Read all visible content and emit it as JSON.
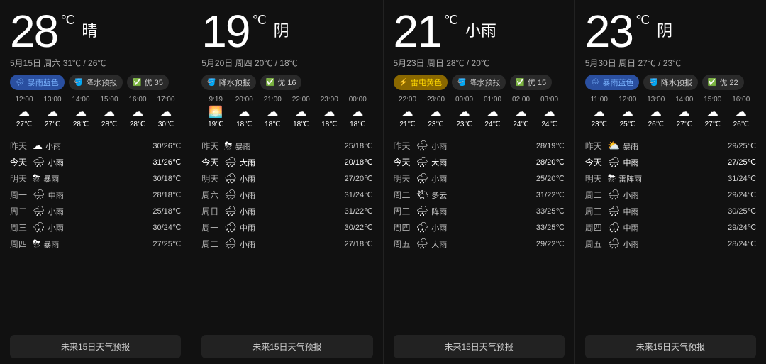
{
  "panels": [
    {
      "id": "panel1",
      "temp": "28",
      "unit": "℃",
      "desc": "晴",
      "date": "5月15日 周六",
      "high": "31℃",
      "low": "26℃",
      "badges": [
        {
          "label": "暴雨蓝色",
          "type": "blue",
          "icon": "🌧"
        },
        {
          "label": "降水预报",
          "type": "dark",
          "icon": "🪣"
        },
        {
          "label": "优 35",
          "type": "dark",
          "icon": "✅"
        }
      ],
      "hourly": [
        {
          "time": "12:00",
          "icon": "☁",
          "temp": "27℃"
        },
        {
          "time": "13:00",
          "icon": "☁",
          "temp": "27℃"
        },
        {
          "time": "14:00",
          "icon": "☁",
          "temp": "28℃"
        },
        {
          "time": "15:00",
          "icon": "☁",
          "temp": "28℃"
        },
        {
          "time": "16:00",
          "icon": "☁",
          "temp": "28℃"
        },
        {
          "time": "17:00",
          "icon": "☁",
          "temp": "30℃"
        }
      ],
      "forecast": [
        {
          "day": "昨天",
          "icon": "☁",
          "label": "小雨",
          "temp": "30/26℃",
          "today": false
        },
        {
          "day": "今天",
          "icon": "🌧",
          "label": "小雨",
          "temp": "31/26℃",
          "today": true
        },
        {
          "day": "明天",
          "icon": "⛈",
          "label": "暴雨",
          "temp": "30/18℃",
          "today": false
        },
        {
          "day": "周一",
          "icon": "🌧",
          "label": "中雨",
          "temp": "28/18℃",
          "today": false
        },
        {
          "day": "周二",
          "icon": "🌧",
          "label": "小雨",
          "temp": "25/18℃",
          "today": false
        },
        {
          "day": "周三",
          "icon": "🌧",
          "label": "小雨",
          "temp": "30/24℃",
          "today": false
        },
        {
          "day": "周四",
          "icon": "⛈",
          "label": "暴雨",
          "temp": "27/25℃",
          "today": false
        }
      ],
      "btn": "未来15日天气预报"
    },
    {
      "id": "panel2",
      "temp": "19",
      "unit": "℃",
      "desc": "阴",
      "date": "5月20日 周四",
      "high": "20℃",
      "low": "18℃",
      "badges": [
        {
          "label": "降水预报",
          "type": "dark",
          "icon": "🪣"
        },
        {
          "label": "优 16",
          "type": "dark",
          "icon": "✅"
        }
      ],
      "hourly": [
        {
          "time": "9:19",
          "icon": "🌅",
          "temp": "19℃"
        },
        {
          "time": "20:00",
          "icon": "☁",
          "temp": "18℃"
        },
        {
          "time": "21:00",
          "icon": "☁",
          "temp": "18℃"
        },
        {
          "time": "22:00",
          "icon": "☁",
          "temp": "18℃"
        },
        {
          "time": "23:00",
          "icon": "☁",
          "temp": "18℃"
        },
        {
          "time": "00:00",
          "icon": "☁",
          "temp": "18℃"
        }
      ],
      "forecast": [
        {
          "day": "昨天",
          "icon": "⛈",
          "label": "暴雨",
          "temp": "25/18℃",
          "today": false
        },
        {
          "day": "今天",
          "icon": "🌧",
          "label": "大雨",
          "temp": "20/18℃",
          "today": true
        },
        {
          "day": "明天",
          "icon": "🌧",
          "label": "小雨",
          "temp": "27/20℃",
          "today": false
        },
        {
          "day": "周六",
          "icon": "🌧",
          "label": "小雨",
          "temp": "31/24℃",
          "today": false
        },
        {
          "day": "周日",
          "icon": "🌧",
          "label": "小雨",
          "temp": "31/22℃",
          "today": false
        },
        {
          "day": "周一",
          "icon": "🌧",
          "label": "中雨",
          "temp": "30/22℃",
          "today": false
        },
        {
          "day": "周二",
          "icon": "🌧",
          "label": "小雨",
          "temp": "27/18℃",
          "today": false
        }
      ],
      "btn": "未来15日天气预报"
    },
    {
      "id": "panel3",
      "temp": "21",
      "unit": "℃",
      "desc": "小雨",
      "date": "5月23日 周日",
      "high": "28℃",
      "low": "20℃",
      "badges": [
        {
          "label": "雷电黄色",
          "type": "yellow",
          "icon": "⚡"
        },
        {
          "label": "降水预报",
          "type": "dark",
          "icon": "🪣"
        },
        {
          "label": "优 15",
          "type": "dark",
          "icon": "✅"
        }
      ],
      "hourly": [
        {
          "time": "22:00",
          "icon": "☁",
          "temp": "21℃"
        },
        {
          "time": "23:00",
          "icon": "☁",
          "temp": "23℃"
        },
        {
          "time": "00:00",
          "icon": "☁",
          "temp": "23℃"
        },
        {
          "time": "01:00",
          "icon": "☁",
          "temp": "24℃"
        },
        {
          "time": "02:00",
          "icon": "☁",
          "temp": "24℃"
        },
        {
          "time": "03:00",
          "icon": "☁",
          "temp": "24℃"
        }
      ],
      "forecast": [
        {
          "day": "昨天",
          "icon": "🌧",
          "label": "小雨",
          "temp": "28/19℃",
          "today": false
        },
        {
          "day": "今天",
          "icon": "🌧",
          "label": "大雨",
          "temp": "28/20℃",
          "today": true
        },
        {
          "day": "明天",
          "icon": "🌧",
          "label": "小雨",
          "temp": "25/20℃",
          "today": false
        },
        {
          "day": "周二",
          "icon": "🌤",
          "label": "多云",
          "temp": "31/22℃",
          "today": false
        },
        {
          "day": "周三",
          "icon": "🌧",
          "label": "阵雨",
          "temp": "33/25℃",
          "today": false
        },
        {
          "day": "周四",
          "icon": "🌧",
          "label": "小雨",
          "temp": "33/25℃",
          "today": false
        },
        {
          "day": "周五",
          "icon": "🌧",
          "label": "大雨",
          "temp": "29/22℃",
          "today": false
        }
      ],
      "btn": "未来15日天气预报"
    },
    {
      "id": "panel4",
      "temp": "23",
      "unit": "℃",
      "desc": "阴",
      "date": "5月30日 周日",
      "high": "27℃",
      "low": "23℃",
      "badges": [
        {
          "label": "暴雨蓝色",
          "type": "blue",
          "icon": "🌧"
        },
        {
          "label": "降水预报",
          "type": "dark",
          "icon": "🪣"
        },
        {
          "label": "优 22",
          "type": "dark",
          "icon": "✅"
        }
      ],
      "hourly": [
        {
          "time": "11:00",
          "icon": "☁",
          "temp": "23℃"
        },
        {
          "time": "12:00",
          "icon": "☁",
          "temp": "25℃"
        },
        {
          "time": "13:00",
          "icon": "☁",
          "temp": "26℃"
        },
        {
          "time": "14:00",
          "icon": "☁",
          "temp": "27℃"
        },
        {
          "time": "15:00",
          "icon": "☁",
          "temp": "27℃"
        },
        {
          "time": "16:00",
          "icon": "☁",
          "temp": "26℃"
        }
      ],
      "forecast": [
        {
          "day": "昨天",
          "icon": "⛅",
          "label": "暴雨",
          "temp": "29/25℃",
          "today": false
        },
        {
          "day": "今天",
          "icon": "🌧",
          "label": "中雨",
          "temp": "27/25℃",
          "today": true
        },
        {
          "day": "明天",
          "icon": "⛈",
          "label": "雷阵雨",
          "temp": "31/24℃",
          "today": false
        },
        {
          "day": "周二",
          "icon": "🌧",
          "label": "小雨",
          "temp": "29/24℃",
          "today": false
        },
        {
          "day": "周三",
          "icon": "🌧",
          "label": "中雨",
          "temp": "30/25℃",
          "today": false
        },
        {
          "day": "周四",
          "icon": "🌧",
          "label": "中雨",
          "temp": "29/24℃",
          "today": false
        },
        {
          "day": "周五",
          "icon": "🌧",
          "label": "小雨",
          "temp": "28/24℃",
          "today": false
        }
      ],
      "btn": "未来15日天气预报"
    }
  ]
}
